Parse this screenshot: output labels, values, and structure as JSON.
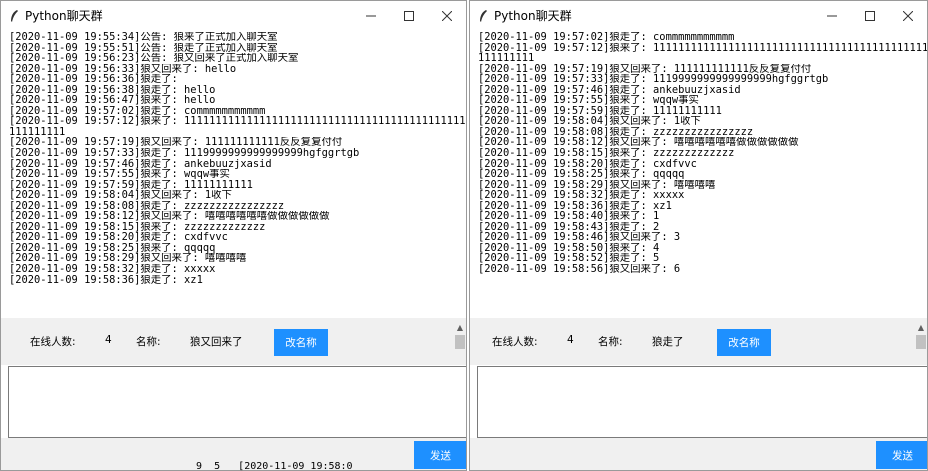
{
  "left": {
    "title": "Python聊天群",
    "messages": [
      "[2020-11-09 19:55:34]公告: 狼来了正式加入聊天室",
      "[2020-11-09 19:55:51]公告: 狼走了正式加入聊天室",
      "[2020-11-09 19:56:23]公告: 狼又回来了正式加入聊天室",
      "[2020-11-09 19:56:33]狼又回来了: hello",
      "[2020-11-09 19:56:36]狼走了:",
      "[2020-11-09 19:56:38]狼走了: hello",
      "[2020-11-09 19:56:47]狼来了: hello",
      "[2020-11-09 19:57:02]狼走了: commmmmmmmmmm",
      "[2020-11-09 19:57:12]狼来了: 111111111111111111111111111111111111111111111111",
      "111111111",
      "[2020-11-09 19:57:19]狼又回来了: 111111111111反反复复付付",
      "[2020-11-09 19:57:33]狼走了: 1119999999999999999hgfggrtgb",
      "[2020-11-09 19:57:46]狼走了: ankebuuzjxasid",
      "[2020-11-09 19:57:55]狼来了: wqqw事实",
      "[2020-11-09 19:57:59]狼走了: 11111111111",
      "[2020-11-09 19:58:04]狼又回来了: 1收下",
      "[2020-11-09 19:58:08]狼走了: zzzzzzzzzzzzzzzz",
      "[2020-11-09 19:58:12]狼又回来了: 嘻嘻嘻嘻嘻嘻做做做做做做",
      "[2020-11-09 19:58:15]狼来了: zzzzzzzzzzzzz",
      "[2020-11-09 19:58:20]狼走了: cxdfvvc",
      "[2020-11-09 19:58:25]狼来了: qqqqq",
      "[2020-11-09 19:58:29]狼又回来了: 嘻嘻嘻嘻",
      "[2020-11-09 19:58:32]狼走了: xxxxx",
      "[2020-11-09 19:58:36]狼走了: xz1"
    ],
    "online_label": "在线人数:",
    "online_count": "4",
    "name_label": "名称:",
    "name_value": "狼又回来了",
    "rename_button": "改名称",
    "send_button": "发送"
  },
  "right": {
    "title": "Python聊天群",
    "messages": [
      "[2020-11-09 19:57:02]狼走了: commmmmmmmmmm",
      "[2020-11-09 19:57:12]狼来了: 111111111111111111111111111111111111111111111111",
      "111111111",
      "[2020-11-09 19:57:19]狼又回来了: 111111111111反反复复付付",
      "[2020-11-09 19:57:33]狼走了: 1119999999999999999hgfggrtgb",
      "[2020-11-09 19:57:46]狼走了: ankebuuzjxasid",
      "[2020-11-09 19:57:55]狼来了: wqqw事实",
      "[2020-11-09 19:57:59]狼走了: 11111111111",
      "[2020-11-09 19:58:04]狼又回来了: 1收下",
      "[2020-11-09 19:58:08]狼走了: zzzzzzzzzzzzzzzz",
      "[2020-11-09 19:58:12]狼又回来了: 嘻嘻嘻嘻嘻嘻做做做做做做",
      "[2020-11-09 19:58:15]狼来了: zzzzzzzzzzzzz",
      "[2020-11-09 19:58:20]狼走了: cxdfvvc",
      "[2020-11-09 19:58:25]狼来了: qqqqq",
      "[2020-11-09 19:58:29]狼又回来了: 嘻嘻嘻嘻",
      "[2020-11-09 19:58:32]狼走了: xxxxx",
      "[2020-11-09 19:58:36]狼走了: xz1",
      "[2020-11-09 19:58:40]狼来了: 1",
      "[2020-11-09 19:58:43]狼走了: 2",
      "[2020-11-09 19:58:46]狼又回来了: 3",
      "[2020-11-09 19:58:50]狼来了: 4",
      "[2020-11-09 19:58:52]狼走了: 5",
      "[2020-11-09 19:58:56]狼又回来了: 6"
    ],
    "online_label": "在线人数:",
    "online_count": "4",
    "name_label": "名称:",
    "name_value": "狼走了",
    "rename_button": "改名称",
    "send_button": "发送"
  },
  "background_text": "_ 9_ 5 _ [2020-11-09 19:58:0"
}
